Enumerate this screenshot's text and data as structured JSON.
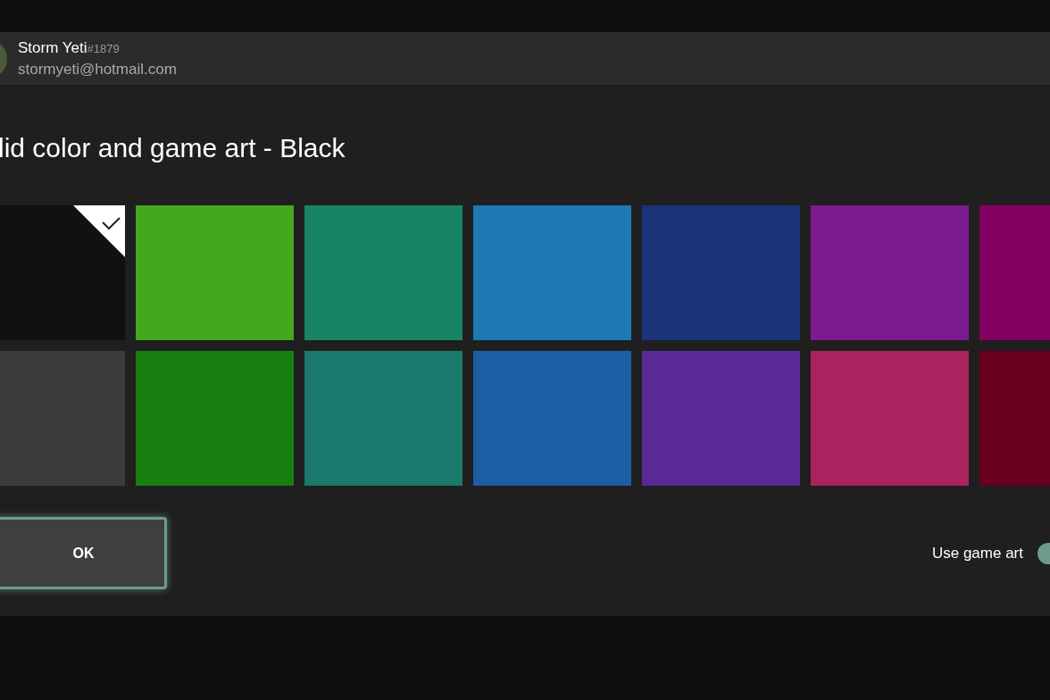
{
  "account": {
    "name": "Storm Yeti",
    "tag": "#1879",
    "email": "stormyeti@hotmail.com"
  },
  "title": "lid color and game art - Black",
  "swatches": [
    [
      {
        "color": "#111111",
        "selected": true
      },
      {
        "color": "#43a81e",
        "selected": false
      },
      {
        "color": "#178563",
        "selected": false
      },
      {
        "color": "#1d79b4",
        "selected": false
      },
      {
        "color": "#19347a",
        "selected": false
      },
      {
        "color": "#7e1a8f",
        "selected": false
      },
      {
        "color": "#840060",
        "selected": false
      }
    ],
    [
      {
        "color": "#3c3c3c",
        "selected": false
      },
      {
        "color": "#177f0f",
        "selected": false
      },
      {
        "color": "#1a7a6d",
        "selected": false
      },
      {
        "color": "#1b5ea4",
        "selected": false
      },
      {
        "color": "#5a2995",
        "selected": false
      },
      {
        "color": "#ab225e",
        "selected": false
      },
      {
        "color": "#6a0020",
        "selected": false
      }
    ]
  ],
  "ok_button": "OK",
  "game_art": {
    "label": "Use game art",
    "on": true
  }
}
